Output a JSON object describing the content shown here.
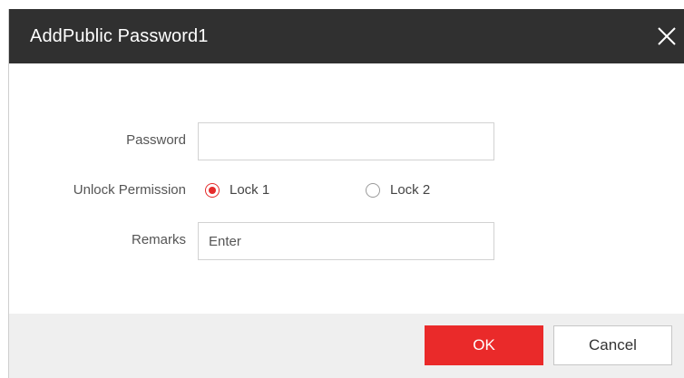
{
  "dialog": {
    "title": "AddPublic Password1",
    "close_icon": "close-icon"
  },
  "form": {
    "password": {
      "label": "Password",
      "value": "",
      "placeholder": ""
    },
    "unlock_permission": {
      "label": "Unlock Permission",
      "options": [
        {
          "label": "Lock 1",
          "checked": true
        },
        {
          "label": "Lock 2",
          "checked": false
        }
      ]
    },
    "remarks": {
      "label": "Remarks",
      "value": "",
      "placeholder": "Enter"
    }
  },
  "footer": {
    "ok_label": "OK",
    "cancel_label": "Cancel"
  },
  "colors": {
    "titlebar": "#303030",
    "accent": "#ea2a2a",
    "footer": "#efefef"
  }
}
